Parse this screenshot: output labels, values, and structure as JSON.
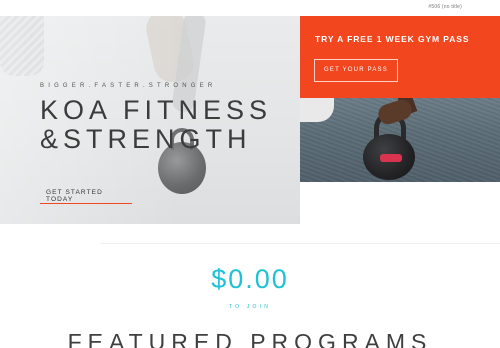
{
  "topbar": {
    "reference": "#506 (no title)"
  },
  "hero": {
    "tagline": "BIGGER.FASTER.STRONGER",
    "title": "KOA FITNESS &STRENGTH",
    "cta_label": "GET STARTED TODAY"
  },
  "promo": {
    "title": "TRY A FREE 1 WEEK GYM PASS",
    "button_label": "GET YOUR PASS",
    "background_color": "#f2461f"
  },
  "pricing": {
    "price": "$0.00",
    "caption": "TO JOIN",
    "accent_color": "#1ec2d6"
  },
  "section": {
    "heading": "FEATURED PROGRAMS"
  },
  "colors": {
    "cta_underline": "#ef4a25"
  }
}
